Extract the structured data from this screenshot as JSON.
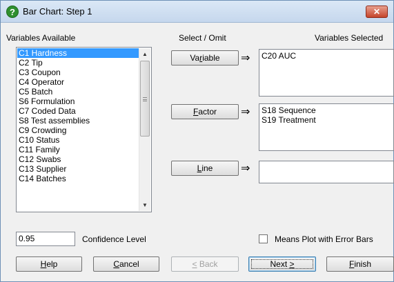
{
  "window": {
    "title": "Bar Chart: Step 1"
  },
  "labels": {
    "variables_available": "Variables Available",
    "select_omit": "Select / Omit",
    "variables_selected": "Variables Selected",
    "confidence_level": "Confidence Level",
    "means_plot": "Means Plot with Error Bars"
  },
  "available_list": [
    "C1 Hardness",
    "C2 Tip",
    "C3 Coupon",
    "C4 Operator",
    "C5 Batch",
    "S6 Formulation",
    "C7 Coded Data",
    "S8 Test assemblies",
    "C9 Crowding",
    "C10 Status",
    "C11 Family",
    "C12 Swabs",
    "C13 Supplier",
    "C14 Batches"
  ],
  "selected_index": 0,
  "buttons": {
    "variable": {
      "pre": "Va",
      "u": "r",
      "post": "iable"
    },
    "factor": {
      "pre": "",
      "u": "F",
      "post": "actor"
    },
    "line": {
      "pre": "",
      "u": "L",
      "post": "ine"
    },
    "help": {
      "pre": "",
      "u": "H",
      "post": "elp"
    },
    "cancel": {
      "pre": "",
      "u": "C",
      "post": "ancel"
    },
    "back": {
      "pre": "",
      "u": "<",
      "post": " Back"
    },
    "next": {
      "pre": "Next ",
      "u": ">",
      "post": ""
    },
    "finish": {
      "pre": "",
      "u": "F",
      "post": "inish"
    }
  },
  "arrow_glyph": "⇒",
  "selected": {
    "variable": [
      "C20 AUC"
    ],
    "factor": [
      "S18 Sequence",
      "S19 Treatment"
    ],
    "line": []
  },
  "confidence_value": "0.95",
  "means_plot_checked": false,
  "icons": {
    "app": "question-icon",
    "close": "close-icon"
  }
}
